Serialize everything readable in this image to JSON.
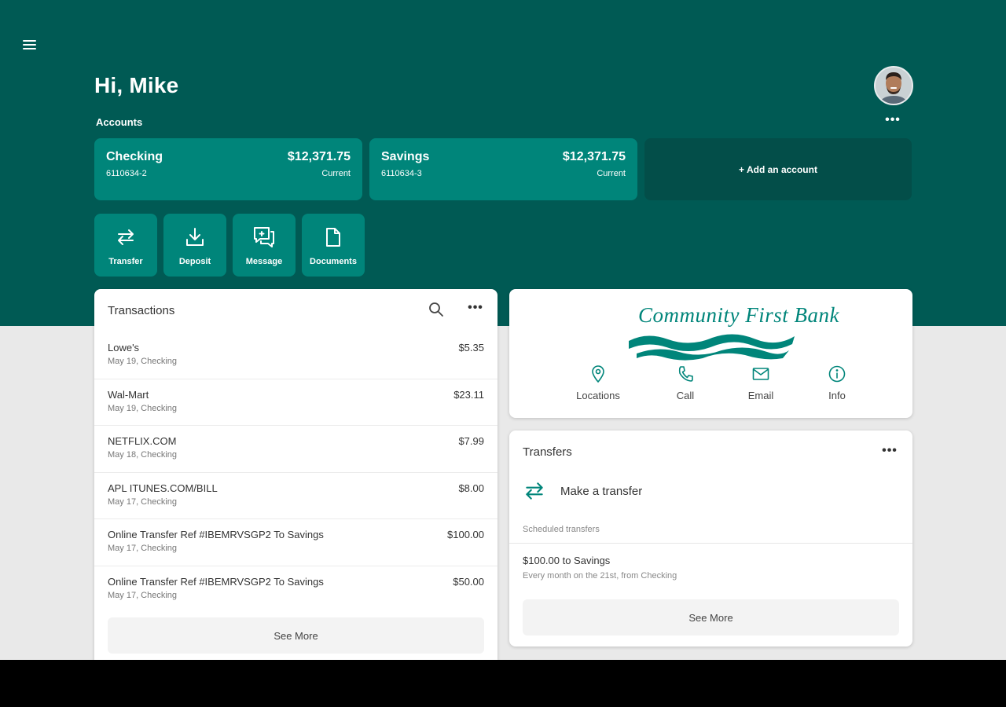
{
  "header": {
    "greeting": "Hi, Mike",
    "accounts_label": "Accounts",
    "more_glyph": "•••"
  },
  "accounts": [
    {
      "name": "Checking",
      "number": "6110634-2",
      "balance": "$12,371.75",
      "status": "Current"
    },
    {
      "name": "Savings",
      "number": "6110634-3",
      "balance": "$12,371.75",
      "status": "Current"
    }
  ],
  "add_account_label": "+ Add an account",
  "actions": [
    {
      "label": "Transfer",
      "icon": "transfer-icon"
    },
    {
      "label": "Deposit",
      "icon": "deposit-icon"
    },
    {
      "label": "Message",
      "icon": "message-icon"
    },
    {
      "label": "Documents",
      "icon": "document-icon"
    }
  ],
  "transactions": {
    "title": "Transactions",
    "more_glyph": "•••",
    "items": [
      {
        "name": "Lowe's",
        "sub": "May 19, Checking",
        "amount": "$5.35"
      },
      {
        "name": "Wal-Mart",
        "sub": "May 19, Checking",
        "amount": "$23.11"
      },
      {
        "name": "NETFLIX.COM",
        "sub": "May 18, Checking",
        "amount": "$7.99"
      },
      {
        "name": "APL ITUNES.COM/BILL",
        "sub": "May 17, Checking",
        "amount": "$8.00"
      },
      {
        "name": "Online Transfer Ref #IBEMRVSGP2 To Savings",
        "sub": "May 17, Checking",
        "amount": "$100.00"
      },
      {
        "name": "Online Transfer Ref #IBEMRVSGP2 To Savings",
        "sub": "May 17, Checking",
        "amount": "$50.00"
      }
    ],
    "see_more": "See More"
  },
  "bank": {
    "logo_text": "Community First Bank",
    "actions": [
      {
        "label": "Locations",
        "icon": "location-pin-icon"
      },
      {
        "label": "Call",
        "icon": "phone-icon"
      },
      {
        "label": "Email",
        "icon": "email-icon"
      },
      {
        "label": "Info",
        "icon": "info-icon"
      }
    ]
  },
  "transfers": {
    "title": "Transfers",
    "more_glyph": "•••",
    "make_transfer": "Make a transfer",
    "scheduled_label": "Scheduled transfers",
    "scheduled_item_title": "$100.00 to Savings",
    "scheduled_item_sub": "Every month on the 21st, from Checking",
    "see_more": "See More"
  },
  "colors": {
    "brand_dark": "#005a54",
    "brand": "#00857a",
    "add_account_bg": "#034e49",
    "page_bg": "#e9e9e9"
  }
}
